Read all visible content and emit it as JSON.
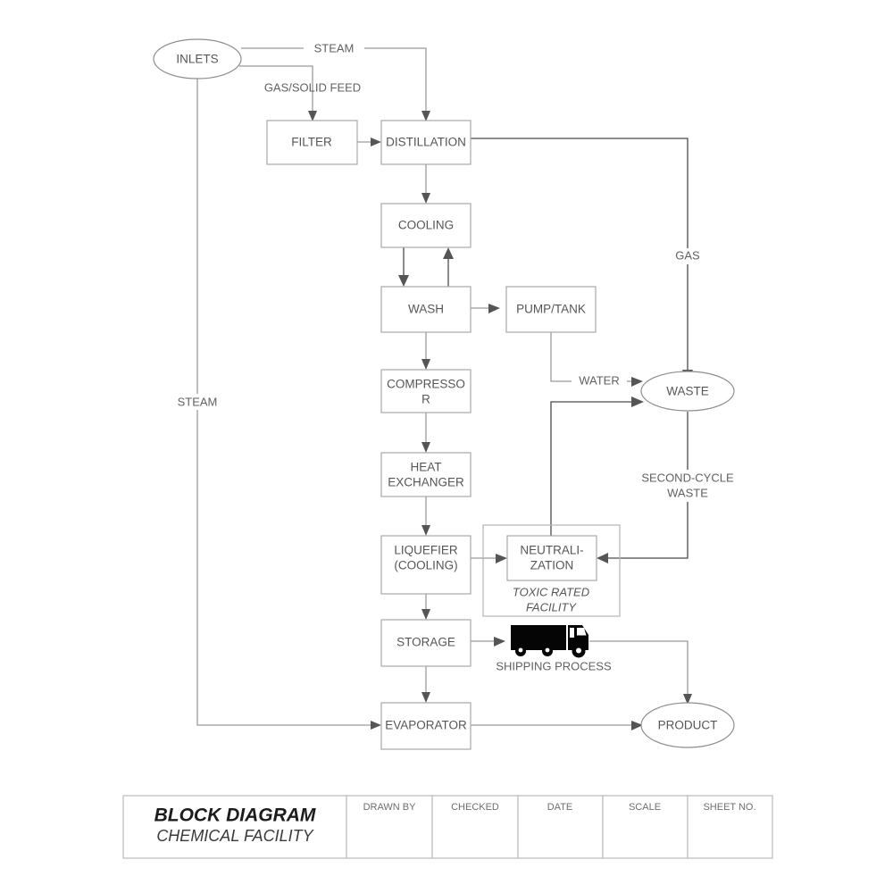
{
  "diagram": {
    "title": "BLOCK DIAGRAM",
    "subtitle": "CHEMICAL FACILITY",
    "nodes": {
      "inlets": "INLETS",
      "filter": "FILTER",
      "distillation": "DISTILLATION",
      "cooling": "COOLING",
      "wash": "WASH",
      "pump_tank": "PUMP/TANK",
      "compressor_line1": "COMPRESSO",
      "compressor_line2": "R",
      "heat_exchanger_line1": "HEAT",
      "heat_exchanger_line2": "EXCHANGER",
      "liquefier_line1": "LIQUEFIER",
      "liquefier_line2": "(COOLING)",
      "neutralization_line1": "NEUTRALI-",
      "neutralization_line2": "ZATION",
      "storage": "STORAGE",
      "evaporator": "EVAPORATOR",
      "waste": "WASTE",
      "product": "PRODUCT"
    },
    "group": {
      "facility_line1": "TOXIC RATED",
      "facility_line2": "FACILITY"
    },
    "edge_labels": {
      "steam_top": "STEAM",
      "gas_solid_feed": "GAS/SOLID FEED",
      "steam_left": "STEAM",
      "gas": "GAS",
      "water": "WATER",
      "second_cycle_line1": "SECOND-CYCLE",
      "second_cycle_line2": "WASTE",
      "shipping_process": "SHIPPING PROCESS"
    },
    "title_block_columns": [
      "DRAWN BY",
      "CHECKED",
      "DATE",
      "SCALE",
      "SHEET NO."
    ],
    "colors": {
      "box_stroke": "#a8a8a8",
      "connector": "#9a9a9a",
      "connector_dark": "#4a4a4a",
      "text": "#565656",
      "truck": "#050505",
      "background": "#ffffff"
    }
  }
}
